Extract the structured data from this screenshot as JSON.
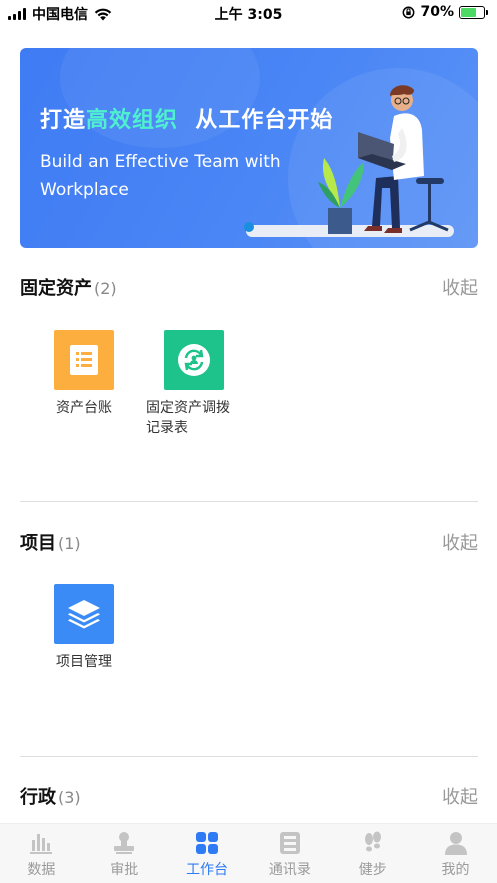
{
  "status_bar": {
    "carrier": "中国电信",
    "time": "上午 3:05",
    "battery": "70%",
    "battery_level": 0.7,
    "battery_color": "#4cd964"
  },
  "banner": {
    "title_prefix": "打造",
    "title_highlight": "高效组织",
    "title_suffix": "从工作台开始",
    "subtitle": "Build an Effective Team with Workplace",
    "highlight_color": "#4ff0d0",
    "bg_color": "#4582f4"
  },
  "sections": [
    {
      "title": "固定资产",
      "count": "(2)",
      "collapse_label": "收起",
      "items": [
        {
          "label": "资产台账",
          "icon": "ledger-icon",
          "color": "#fcae3e"
        },
        {
          "label": "固定资产调拨记录表",
          "icon": "transfer-icon",
          "color": "#1ec28b"
        }
      ]
    },
    {
      "title": "项目",
      "count": "(1)",
      "collapse_label": "收起",
      "items": [
        {
          "label": "项目管理",
          "icon": "layers-icon",
          "color": "#3b8bf6"
        }
      ]
    },
    {
      "title": "行政",
      "count": "(3)",
      "collapse_label": "收起",
      "items": []
    }
  ],
  "tab_bar": {
    "active_color": "#2e7bf5",
    "inactive_color": "#9a9a9a",
    "tabs": [
      {
        "label": "数据",
        "icon": "chart-icon"
      },
      {
        "label": "审批",
        "icon": "stamp-icon"
      },
      {
        "label": "工作台",
        "icon": "grid-icon",
        "active": true
      },
      {
        "label": "通讯录",
        "icon": "contacts-icon"
      },
      {
        "label": "健步",
        "icon": "footprint-icon"
      },
      {
        "label": "我的",
        "icon": "user-icon"
      }
    ]
  }
}
